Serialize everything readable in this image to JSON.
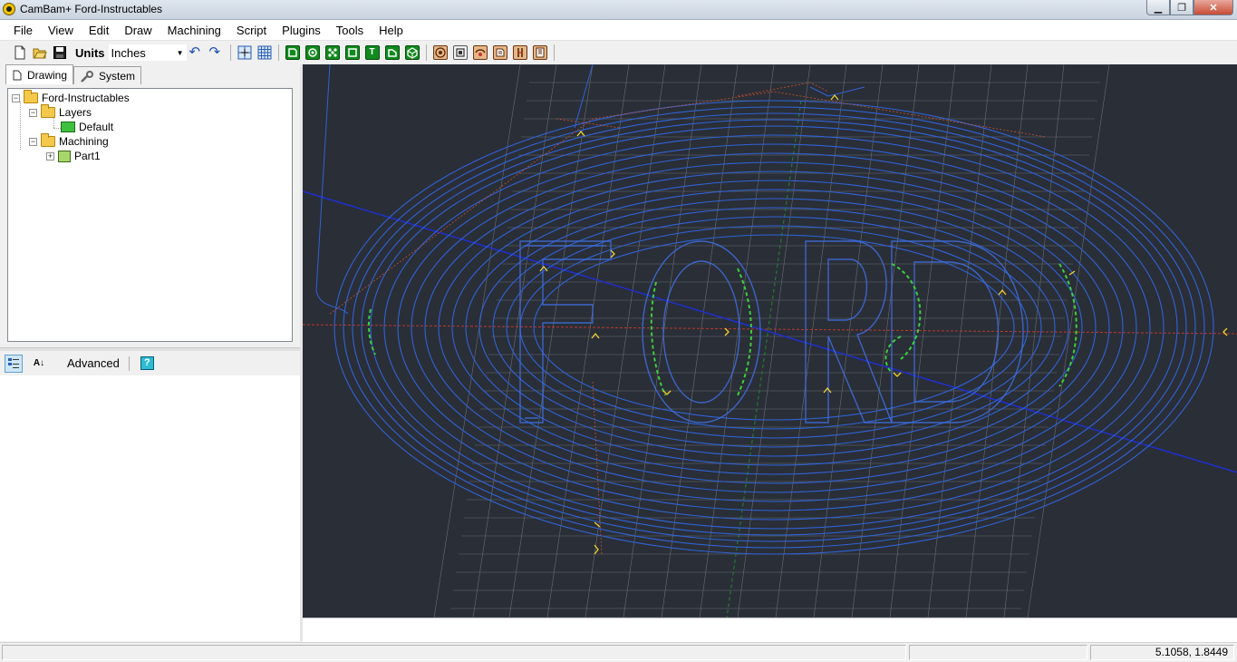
{
  "window": {
    "title": "CamBam+  Ford-Instructables",
    "minimize": "▁",
    "restore": "❐",
    "close": "✕"
  },
  "menu": [
    "File",
    "View",
    "Edit",
    "Draw",
    "Machining",
    "Script",
    "Plugins",
    "Tools",
    "Help"
  ],
  "toolbar": {
    "units_label": "Units",
    "units_value": "Inches",
    "redo_glyph": "↷",
    "undo_glyph": "↶",
    "text_tool_glyph": "T"
  },
  "tabs": {
    "drawing": "Drawing",
    "system": "System"
  },
  "tree": {
    "root": "Ford-Instructables",
    "layers": "Layers",
    "default_layer": "Default",
    "machining": "Machining",
    "part": "Part1"
  },
  "properties": {
    "advanced_label": "Advanced",
    "help_glyph": "?",
    "sort_glyph": "A↓"
  },
  "status": {
    "pane1": "",
    "pane2": "",
    "coords": "5.1058, 1.8449"
  },
  "colors": {
    "viewport_bg": "#2a2e37",
    "toolpath": "#2f64d6",
    "grid": "#8a8f99",
    "accent_green": "#118a1e"
  }
}
